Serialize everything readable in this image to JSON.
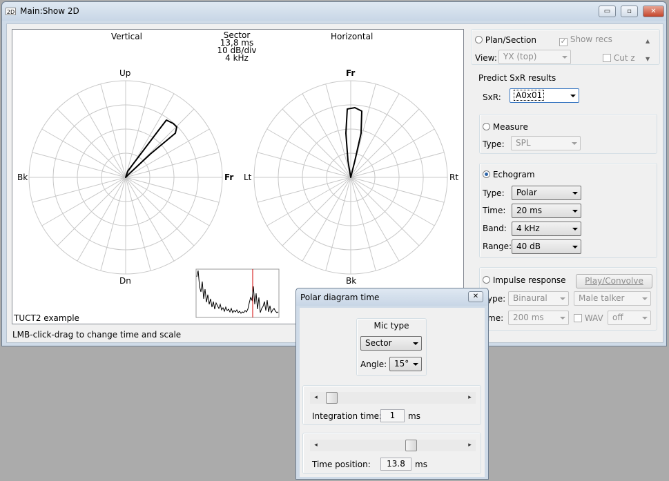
{
  "window": {
    "title": "Main:Show 2D",
    "icon_label": "2D",
    "buttons": {
      "minimize": "▭",
      "maximize": "▫",
      "close": "✕"
    }
  },
  "plot": {
    "left_title": "Vertical",
    "right_title": "Horizontal",
    "center_info": [
      "Sector",
      "13,8 ms",
      "10 dB/div",
      "4 kHz"
    ],
    "vertical_labels": {
      "up": "Up",
      "down": "Dn",
      "left": "Bk",
      "right": "Fr"
    },
    "horizontal_labels": {
      "up": "Fr",
      "down": "Bk",
      "left": "Lt",
      "right": "Rt"
    },
    "example_label": "TUCT2 example",
    "status": "LMB-click-drag to change time and scale"
  },
  "panel": {
    "plan_section": "Plan/Section",
    "show_recs": "Show recs",
    "view_label": "View:",
    "view_value": "YX (top)",
    "cut_z": "Cut z",
    "predict_heading": "Predict SxR results",
    "sxr_label": "SxR:",
    "sxr_value": "A0x01",
    "measure": {
      "label": "Measure",
      "type_label": "Type:",
      "type_value": "SPL"
    },
    "echogram": {
      "label": "Echogram",
      "type_label": "Type:",
      "type_value": "Polar",
      "time_label": "Time:",
      "time_value": "20 ms",
      "band_label": "Band:",
      "band_value": "4 kHz",
      "range_label": "Range:",
      "range_value": "40 dB"
    },
    "impulse": {
      "label": "Impulse response",
      "play_button": "Play/Convolve",
      "type_label": "ype:",
      "type_value": "Binaural",
      "talker_value": "Male talker",
      "time_label": "me:",
      "time_value": "200 ms",
      "wav_label": "WAV",
      "wav_value": "off"
    }
  },
  "dialog": {
    "title": "Polar diagram time",
    "close": "✕",
    "mic_type_label": "Mic type",
    "mic_type_value": "Sector",
    "angle_label": "Angle:",
    "angle_value": "15°",
    "integration_label": "Integration time:",
    "integration_value": "1",
    "integration_unit": "ms",
    "integration_slider": 0.03,
    "position_label": "Time position:",
    "position_value": "13.8",
    "position_unit": "ms",
    "position_slider": 0.64
  }
}
